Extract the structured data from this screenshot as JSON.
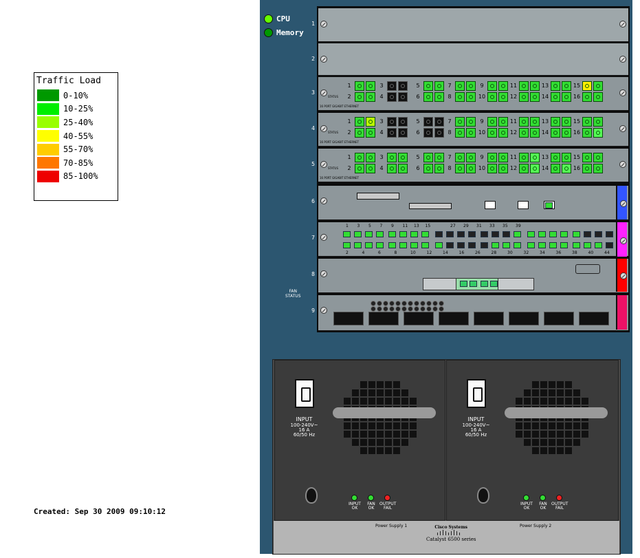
{
  "legend": {
    "title": "Traffic Load",
    "items": [
      {
        "label": "0-10%",
        "color": "#009900"
      },
      {
        "label": "10-25%",
        "color": "#00ee00"
      },
      {
        "label": "25-40%",
        "color": "#99ff00"
      },
      {
        "label": "40-55%",
        "color": "#ffff00"
      },
      {
        "label": "55-70%",
        "color": "#ffcc00"
      },
      {
        "label": "70-85%",
        "color": "#ff7700"
      },
      {
        "label": "85-100%",
        "color": "#ee0000"
      }
    ]
  },
  "status": {
    "cpu": {
      "label": "CPU",
      "color": "#66ff00"
    },
    "memory": {
      "label": "Memory",
      "color": "#009900"
    }
  },
  "created": "Created: Sep 30 2009 09:10:12",
  "fan_status": "FAN\nSTATUS",
  "slots": [
    "1",
    "2",
    "3",
    "4",
    "5",
    "6",
    "7",
    "8",
    "9"
  ],
  "module_text": {
    "gig_ethernet": "16 PORT GIGABIT ETHERNET",
    "status": "STATUS",
    "slot7_top_numbers": [
      "1",
      "3",
      "5",
      "7",
      "9",
      "11",
      "13",
      "15",
      "27",
      "29",
      "31",
      "33",
      "35",
      "39"
    ],
    "slot7_bottom_numbers": [
      "2",
      "4",
      "6",
      "8",
      "10",
      "12",
      "14",
      "16",
      "26",
      "28",
      "30",
      "32",
      "34",
      "36",
      "38",
      "40",
      "44"
    ]
  },
  "port_colors": {
    "3": {
      "odd": [
        "#33dd33",
        "#111111",
        "#33dd33",
        "#33dd33",
        "#33dd33",
        "#33dd33",
        "#33dd33",
        "#ffee00"
      ],
      "even": [
        "#33dd33",
        "#111111",
        "#33dd33",
        "#33dd33",
        "#33dd33",
        "#33dd33",
        "#33dd33",
        "#33dd33"
      ],
      "odd_b": [
        "#33dd33",
        "#111111",
        "#33dd33",
        "#33dd33",
        "#33dd33",
        "#33dd33",
        "#33dd33",
        "#33dd33"
      ],
      "even_b": [
        "#33dd33",
        "#111111",
        "#33dd33",
        "#33dd33",
        "#33dd33",
        "#33dd33",
        "#33dd33",
        "#33dd33"
      ]
    },
    "4": {
      "odd": [
        "#33dd33",
        "#111111",
        "#111111",
        "#33dd33",
        "#33dd33",
        "#33dd33",
        "#33dd33",
        "#33dd33"
      ],
      "even": [
        "#33dd33",
        "#111111",
        "#111111",
        "#33dd33",
        "#33dd33",
        "#33dd33",
        "#33dd33",
        "#33dd33"
      ],
      "odd_b": [
        "#bbff00",
        "#111111",
        "#111111",
        "#33dd33",
        "#33dd33",
        "#33dd33",
        "#33dd33",
        "#33dd33"
      ],
      "even_b": [
        "#33dd33",
        "#111111",
        "#111111",
        "#33dd33",
        "#33dd33",
        "#33dd33",
        "#33dd33",
        "#55ff55"
      ]
    },
    "5": {
      "odd": [
        "#33dd33",
        "#33dd33",
        "#33dd33",
        "#33dd33",
        "#33dd33",
        "#33dd33",
        "#33dd33",
        "#33dd33"
      ],
      "even": [
        "#33dd33",
        "#33dd33",
        "#33dd33",
        "#33dd33",
        "#33dd33",
        "#33dd33",
        "#33dd33",
        "#33dd33"
      ],
      "odd_b": [
        "#33dd33",
        "#33dd33",
        "#33dd33",
        "#33dd33",
        "#33dd33",
        "#55ff55",
        "#33dd33",
        "#33dd33"
      ],
      "even_b": [
        "#33dd33",
        "#33dd33",
        "#33dd33",
        "#33dd33",
        "#33dd33",
        "#55ff55",
        "#55ff55",
        "#33dd33"
      ]
    }
  },
  "slot_tabs": {
    "6": "#3355ff",
    "7": "#ff22ff",
    "8": "#ff0000",
    "9": "#ee1166"
  },
  "power_supplies": [
    {
      "name": "Power Supply 1",
      "input_text": "INPUT",
      "rating": "100-240V~\n16 A\n60/50 Hz",
      "leds": [
        {
          "label": "INPUT\nOK",
          "color": "#33dd33"
        },
        {
          "label": "FAN\nOK",
          "color": "#33dd33"
        },
        {
          "label": "OUTPUT\nFAIL",
          "color": "#ee2222"
        }
      ]
    },
    {
      "name": "Power Supply 2",
      "input_text": "INPUT",
      "rating": "100-240V~\n16 A\n60/50 Hz",
      "leds": [
        {
          "label": "INPUT\nOK",
          "color": "#33dd33"
        },
        {
          "label": "FAN\nOK",
          "color": "#33dd33"
        },
        {
          "label": "OUTPUT\nFAIL",
          "color": "#ee2222"
        }
      ]
    }
  ],
  "brand": {
    "vendor": "Cisco Systems",
    "model": "Catalyst 6500 series"
  }
}
